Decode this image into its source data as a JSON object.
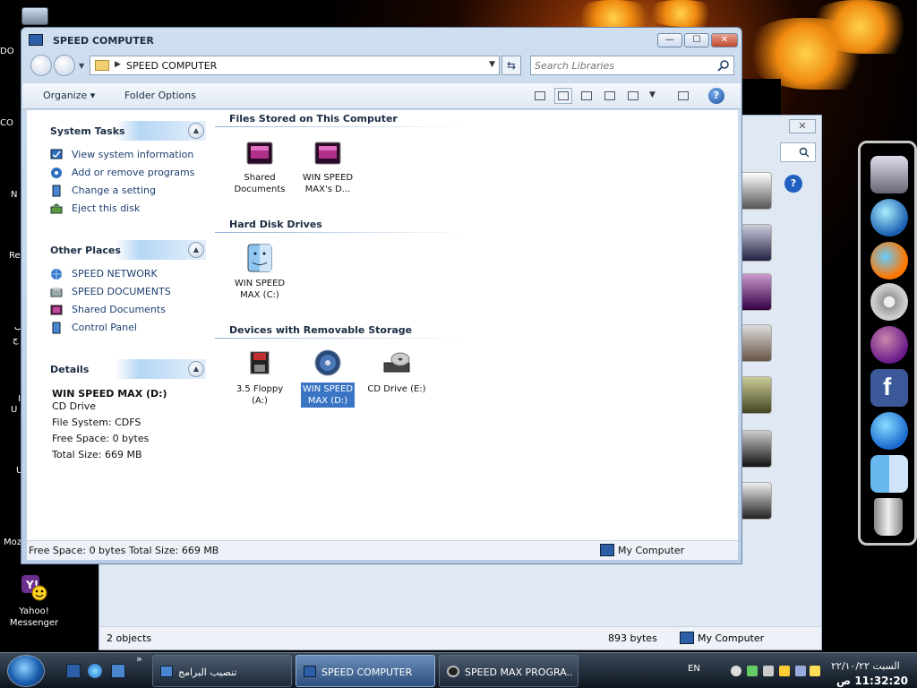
{
  "window": {
    "title": "SPEED COMPUTER",
    "address": "SPEED COMPUTER",
    "search_placeholder": "Search Libraries",
    "minimize": "—",
    "maximize": "☐",
    "close": "✕",
    "help": "?"
  },
  "commandbar": {
    "organize": "Organize ▾",
    "folder_options": "Folder Options"
  },
  "sidebar": {
    "system_tasks": {
      "title": "System Tasks",
      "items": [
        "View system information",
        "Add or remove programs",
        "Change a setting",
        "Eject this disk"
      ]
    },
    "other_places": {
      "title": "Other Places",
      "items": [
        "SPEED NETWORK",
        "SPEED DOCUMENTS",
        "Shared Documents",
        "Control Panel"
      ]
    },
    "details": {
      "title": "Details",
      "name": "WIN SPEED MAX (D:)",
      "type": "CD Drive",
      "file_system": "File System: CDFS",
      "free_space": "Free Space: 0 bytes",
      "total_size": "Total Size: 669 MB"
    }
  },
  "groups": {
    "files_stored": {
      "title": "Files Stored on This Computer",
      "items": [
        {
          "line1": "Shared",
          "line2": "Documents"
        },
        {
          "line1": "WIN SPEED",
          "line2": "MAX's D..."
        }
      ]
    },
    "hard_disks": {
      "title": "Hard Disk Drives",
      "items": [
        {
          "line1": "WIN SPEED",
          "line2": "MAX (C:)"
        }
      ]
    },
    "removable": {
      "title": "Devices with Removable Storage",
      "items": [
        {
          "line1": "3.5 Floppy",
          "line2": "(A:)"
        },
        {
          "line1": "WIN SPEED",
          "line2": "MAX (D:)"
        },
        {
          "line1": "CD Drive (E:)",
          "line2": ""
        }
      ]
    }
  },
  "statusbar": {
    "left": "Free Space: 0 bytes Total Size: 669 MB",
    "right": "My Computer"
  },
  "background_window": {
    "objects": "2 objects",
    "size": "893 bytes",
    "location": "My Computer",
    "close": "✕"
  },
  "desktop": {
    "edge_labels": [
      "DO",
      "CO",
      "N",
      "Re",
      "ب",
      "ج",
      "I",
      "U",
      "U",
      "Moz"
    ],
    "icons": [
      {
        "label_line1": "Yahoo!",
        "label_line2": "Messenger"
      }
    ]
  },
  "taskbar": {
    "tasks": [
      {
        "label": "تنصيب البرامج"
      },
      {
        "label": "SPEED COMPUTER"
      },
      {
        "label": "SPEED MAX PROGRA..."
      }
    ],
    "language": "EN",
    "clock_date": "السبت ٢٢/١٠/٢٢",
    "clock_time": "11:32:20 ص",
    "quicklaunch_more": "»"
  },
  "colors": {
    "selection": "#3a75c4",
    "title_text": "#1b2c44",
    "link_text": "#1b3f70"
  }
}
